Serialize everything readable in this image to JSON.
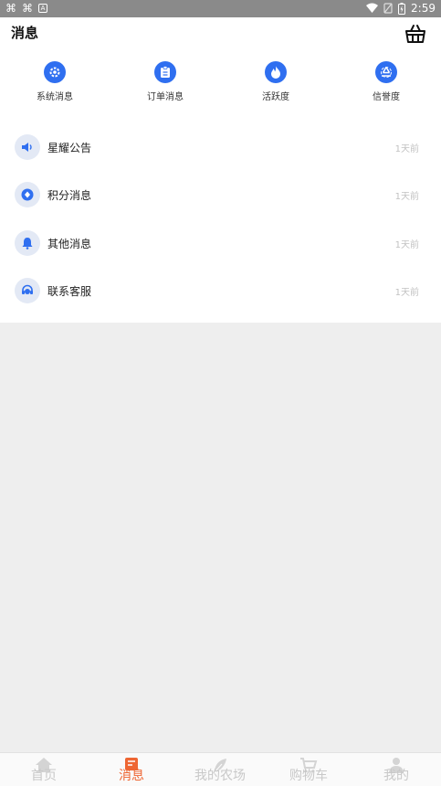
{
  "status_bar": {
    "time": "2:59"
  },
  "header": {
    "title": "消息"
  },
  "quick_entries": [
    {
      "label": "系统消息",
      "icon": "gear-icon"
    },
    {
      "label": "订单消息",
      "icon": "clipboard-icon"
    },
    {
      "label": "活跃度",
      "icon": "flame-icon"
    },
    {
      "label": "信誉度",
      "icon": "recycle-icon"
    }
  ],
  "messages": [
    {
      "label": "星耀公告",
      "time": "1天前",
      "icon": "speaker-icon"
    },
    {
      "label": "积分消息",
      "time": "1天前",
      "icon": "diamond-icon"
    },
    {
      "label": "其他消息",
      "time": "1天前",
      "icon": "bell-icon"
    },
    {
      "label": "联系客服",
      "time": "1天前",
      "icon": "headset-icon"
    }
  ],
  "tabs": [
    {
      "label": "首页",
      "icon": "home-icon",
      "active": false
    },
    {
      "label": "消息",
      "icon": "message-icon",
      "active": true
    },
    {
      "label": "我的农场",
      "icon": "leaf-icon",
      "active": false
    },
    {
      "label": "购物车",
      "icon": "cart-icon",
      "active": false
    },
    {
      "label": "我的",
      "icon": "user-icon",
      "active": false
    }
  ],
  "colors": {
    "accent": "#2f6ff0",
    "active_tab": "#ee6633"
  }
}
